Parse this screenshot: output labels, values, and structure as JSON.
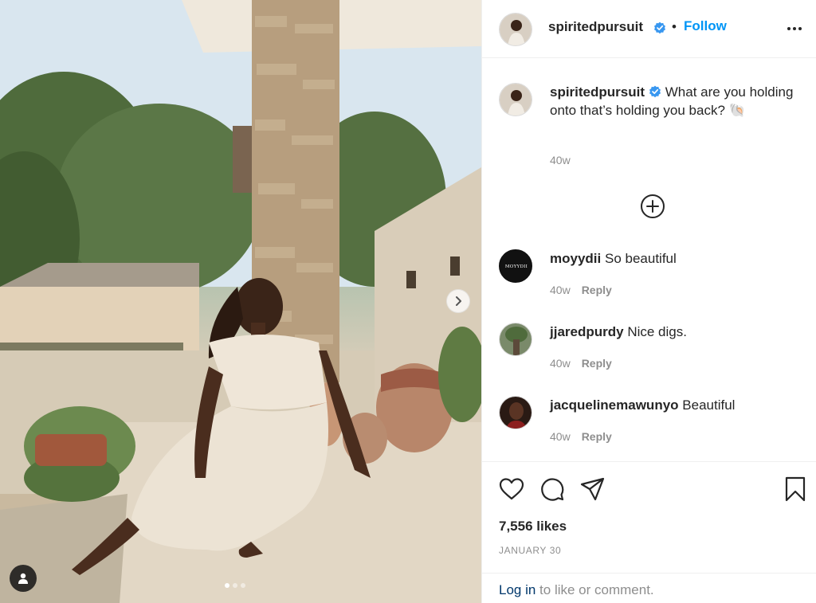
{
  "post": {
    "username": "spiritedpursuit",
    "follow_label": "Follow",
    "separator": "•"
  },
  "caption": {
    "username": "spiritedpursuit",
    "text": "What are you holding onto that’s holding you back? 🐚",
    "age": "40w"
  },
  "comments": [
    {
      "username": "moyydii",
      "text": "So beautiful",
      "age": "40w",
      "reply_label": "Reply",
      "avatar_text": "MOYYDII"
    },
    {
      "username": "jjaredpurdy",
      "text": "Nice digs.",
      "age": "40w",
      "reply_label": "Reply"
    },
    {
      "username": "jacquelinemawunyo",
      "text": "Beautiful",
      "age": "40w",
      "reply_label": "Reply"
    }
  ],
  "engagement": {
    "likes": "7,556 likes",
    "date": "JANUARY 30"
  },
  "login_prompt": {
    "link": "Log in",
    "rest": " to like or comment."
  },
  "carousel": {
    "total": 3,
    "active": 0
  },
  "icons": {
    "verified": "verified-badge-icon",
    "more": "more-options-icon",
    "load_more": "plus-circle-icon",
    "like": "heart-icon",
    "comment": "comment-bubble-icon",
    "share": "paper-plane-icon",
    "save": "bookmark-icon",
    "next": "chevron-right-icon",
    "tags": "user-tag-icon"
  },
  "colors": {
    "accent": "#0095f6",
    "verified": "#3897f0",
    "text": "#262626",
    "muted": "#8e8e8e",
    "link": "#00376b"
  }
}
